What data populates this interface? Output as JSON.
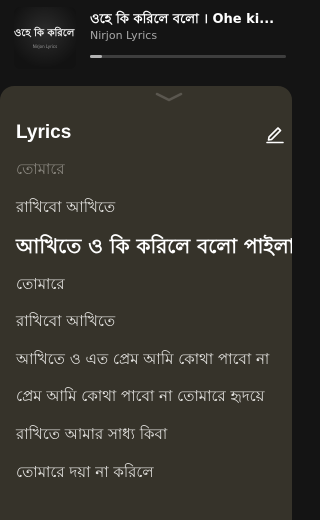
{
  "now_playing": {
    "album_art_title": "ওহে কি করিলে বলো",
    "album_art_subtitle": "Nirjon Lyrics",
    "title": "ওহে কি করিলে বলো । Ohe ki...",
    "artist": "Nirjon Lyrics",
    "progress_fraction": 0.06
  },
  "lyrics": {
    "heading": "Lyrics",
    "lines": [
      {
        "text": "তোমারে",
        "state": "fade"
      },
      {
        "text": "রাখিবো আখিতে",
        "state": "normal"
      },
      {
        "text": "আখিতে ও কি করিলে বলো পাইলা",
        "state": "active"
      },
      {
        "text": "তোমারে",
        "state": "normal"
      },
      {
        "text": "রাখিবো আখিতে",
        "state": "normal"
      },
      {
        "text": "আখিতে ও এত প্রেম আমি কোথা পাবো না",
        "state": "normal"
      },
      {
        "text": "প্রেম আমি কোথা পাবো না তোমারে হৃদয়ে",
        "state": "normal"
      },
      {
        "text": "রাখিতে আমার সাধ্য কিবা",
        "state": "normal"
      },
      {
        "text": "তোমারে দয়া না করিলে",
        "state": "normal"
      },
      {
        "text": "",
        "state": "fade"
      }
    ]
  },
  "icons": {
    "handle": "chevron-down-icon",
    "edit": "pencil-icon"
  },
  "colors": {
    "app_background": "#141414",
    "sheet_background": "#36332a",
    "text_primary": "#ffffff",
    "text_secondary": "#a7a7a7"
  }
}
